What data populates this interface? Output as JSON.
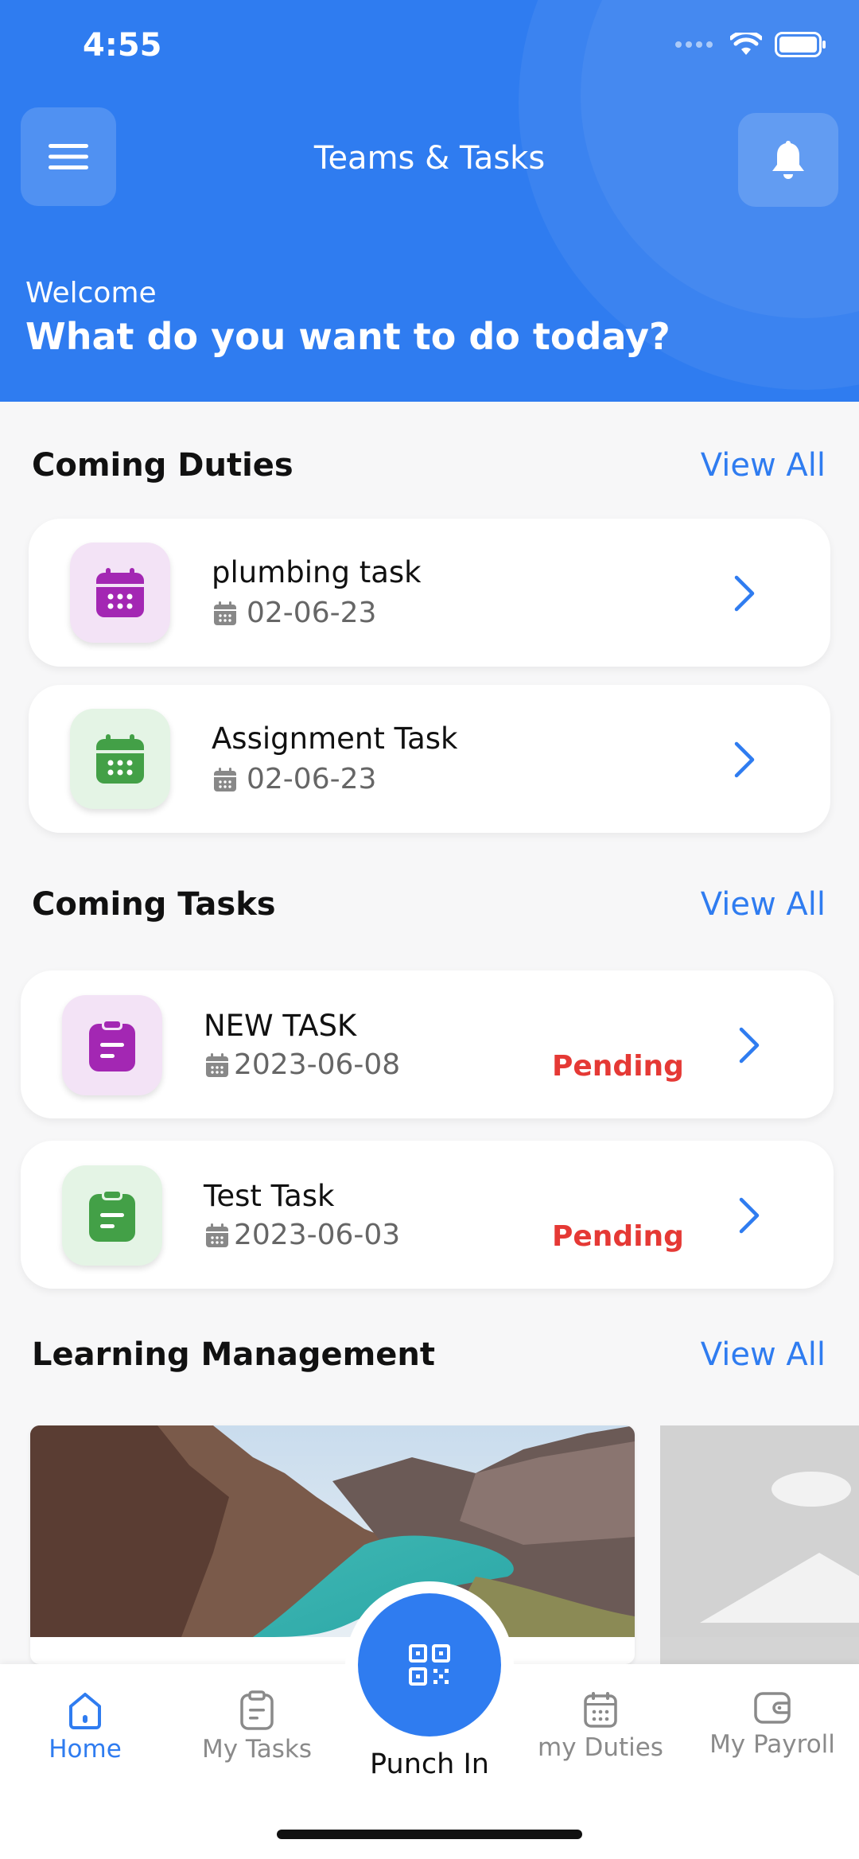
{
  "status_bar": {
    "time": "4:55"
  },
  "header": {
    "title": "Teams & Tasks",
    "welcome": "Welcome",
    "headline": "What do you want to do today?"
  },
  "duties": {
    "section_title": "Coming Duties",
    "view_all": "View All",
    "items": [
      {
        "title": "plumbing task",
        "date": "02-06-23",
        "icon_color": "#a327b3",
        "icon_bg": "#f3e3f6",
        "icon": "calendar-icon"
      },
      {
        "title": "Assignment Task",
        "date": "02-06-23",
        "icon_color": "#43a047",
        "icon_bg": "#e4f4e5",
        "icon": "calendar-icon"
      }
    ]
  },
  "tasks": {
    "section_title": "Coming Tasks",
    "view_all": "View All",
    "items": [
      {
        "title": "NEW TASK",
        "date": "2023-06-08",
        "status": "Pending",
        "icon_color": "#a327b3",
        "icon_bg": "#f3e3f6",
        "icon": "clipboard-icon"
      },
      {
        "title": "Test Task",
        "date": "2023-06-03",
        "status": "Pending",
        "icon_color": "#43a047",
        "icon_bg": "#e4f4e5",
        "icon": "clipboard-icon"
      }
    ]
  },
  "learning": {
    "section_title": "Learning Management",
    "view_all": "View All"
  },
  "bottom_nav": {
    "items": [
      {
        "label": "Home",
        "icon": "home-icon",
        "active": true
      },
      {
        "label": "My Tasks",
        "icon": "clipboard-icon",
        "active": false
      },
      {
        "label": "my Duties",
        "icon": "calendar-icon",
        "active": false
      },
      {
        "label": "My Payroll",
        "icon": "wallet-icon",
        "active": false
      }
    ],
    "punch_label": "Punch In"
  },
  "colors": {
    "primary": "#2f7cf0",
    "pending": "#e53935"
  }
}
